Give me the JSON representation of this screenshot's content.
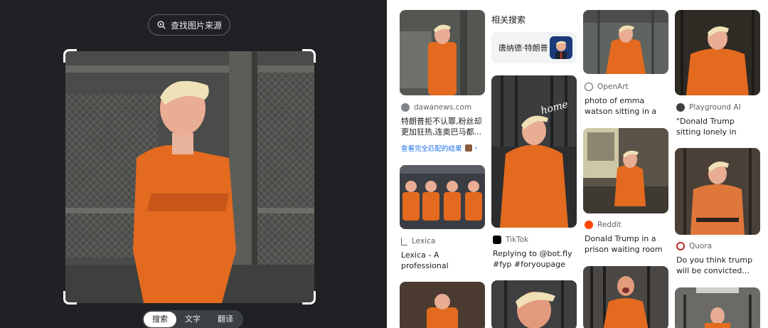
{
  "lens": {
    "source_button_label": "查找图片来源",
    "modes": [
      "搜索",
      "文字",
      "翻译"
    ],
    "active_mode": "搜索"
  },
  "related": {
    "heading": "相关搜索",
    "chip_label": "唐纳德·特朗普"
  },
  "results": [
    {
      "source": "dawanews.com",
      "title": "特朗普拒不认罪,粉丝却更加狂热,连奥巴马都...",
      "exact_link": "查看完全匹配的结果"
    },
    {
      "source": "Lexica",
      "title": "Lexica - A professional mugsho..."
    },
    {
      "source": "TikTok",
      "title": "Replying to @bot.fly #fyp #foryoupage |..."
    },
    {
      "source": "OpenArt",
      "title": "photo of emma watson sitting in a ja..."
    },
    {
      "source": "Reddit",
      "title": "Donald Trump in a prison waiting room ..."
    },
    {
      "source": "Playground AI",
      "title": "\"Donald Trump sitting lonely in prison in..."
    },
    {
      "source": "Quora",
      "title": "Do you think trump will be convicted..."
    }
  ],
  "colors": {
    "panel_bg": "#202124",
    "orange": "#e36a1f",
    "link_blue": "#1a73e8"
  }
}
